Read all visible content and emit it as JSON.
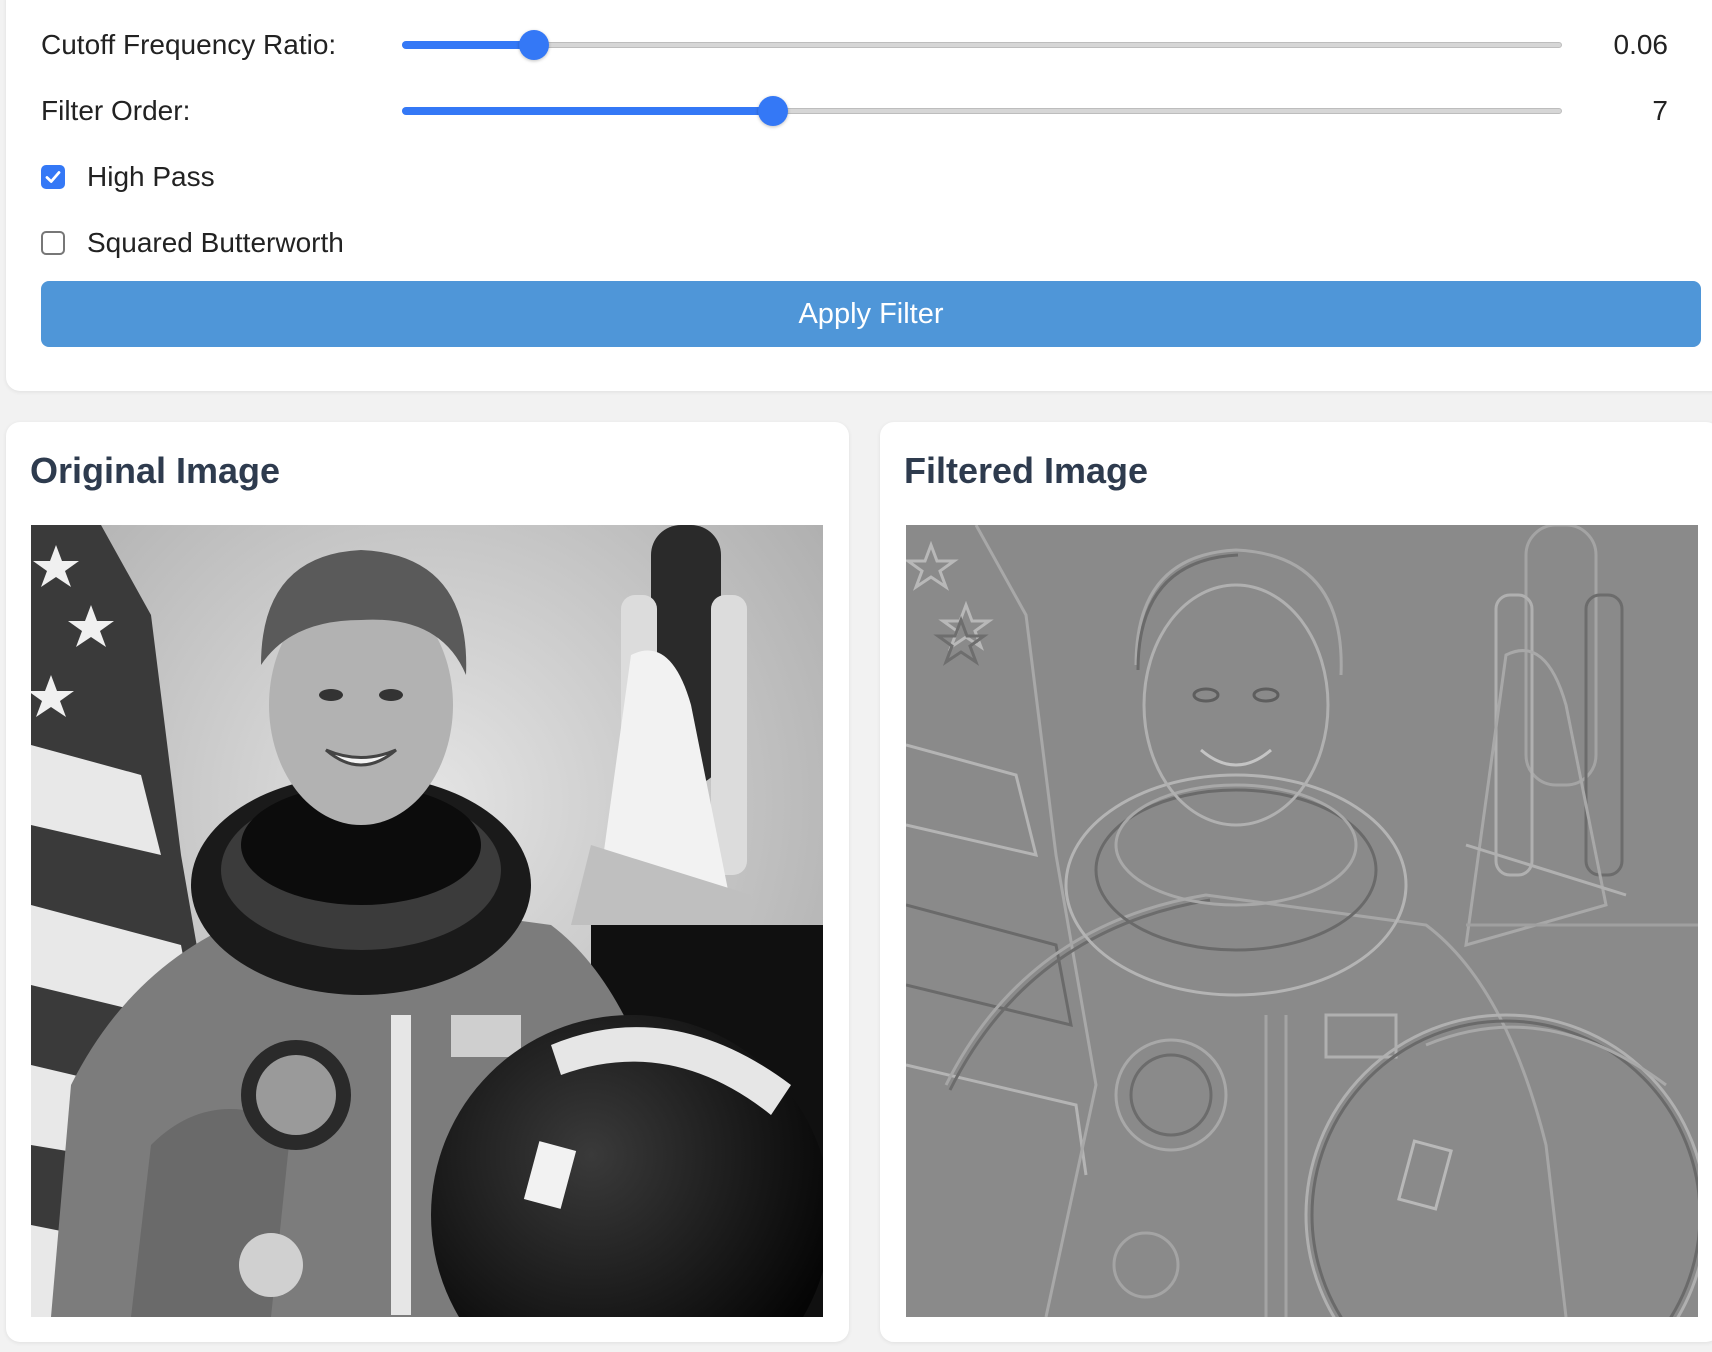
{
  "controls": {
    "cutoff": {
      "label": "Cutoff Frequency Ratio:",
      "value": "0.06",
      "fraction": 0.114
    },
    "order": {
      "label": "Filter Order:",
      "value": "7",
      "fraction": 0.32
    },
    "high_pass": {
      "label": "High Pass",
      "checked": true
    },
    "squared_butterworth": {
      "label": "Squared Butterworth",
      "checked": false
    },
    "apply_label": "Apply Filter"
  },
  "panels": {
    "original": {
      "title": "Original Image"
    },
    "filtered": {
      "title": "Filtered Image"
    }
  },
  "colors": {
    "accent": "#3478f6",
    "button": "#4f96d8",
    "title": "#2e3b4e"
  }
}
